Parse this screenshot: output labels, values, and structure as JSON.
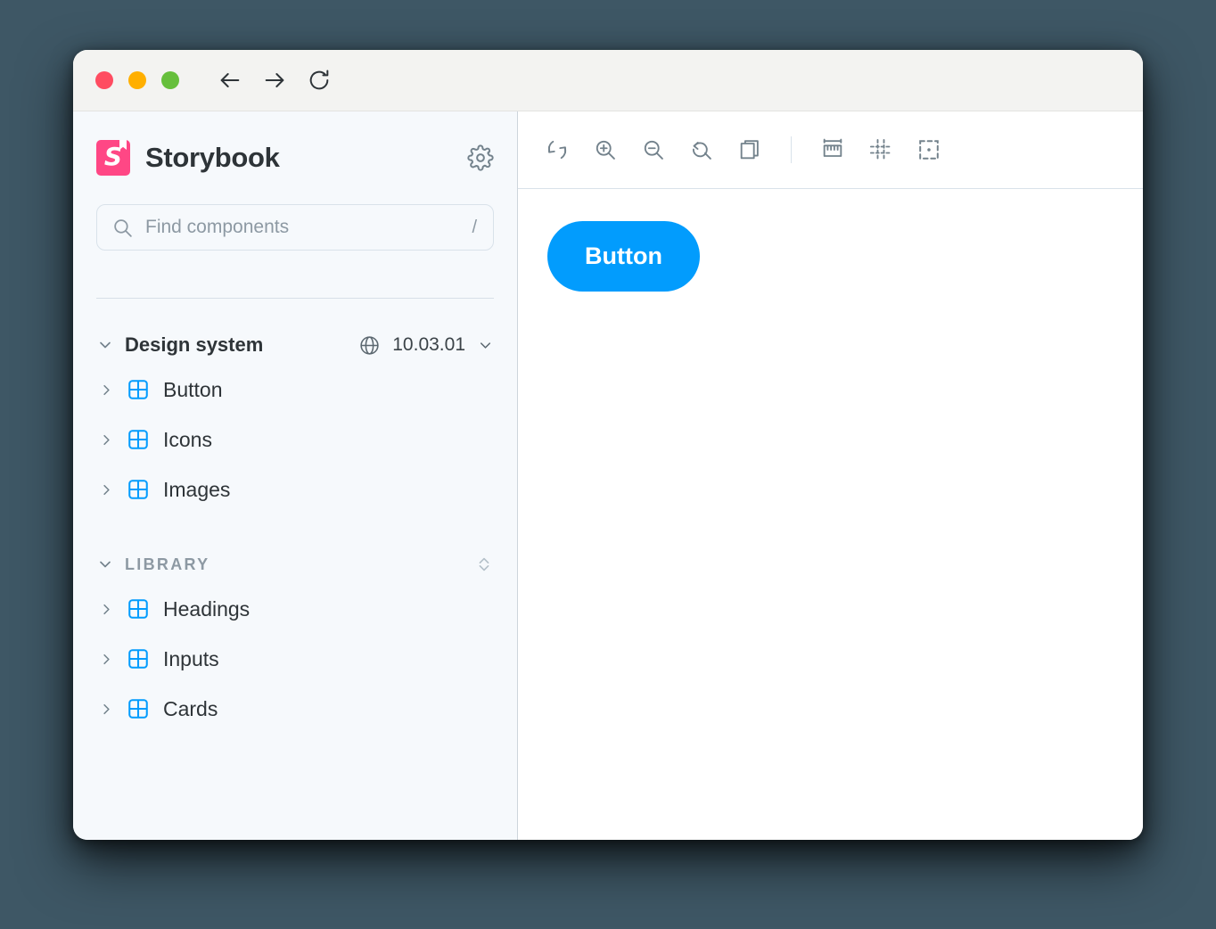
{
  "window": {
    "traffic_lights": [
      {
        "name": "close",
        "color": "#ff4c61"
      },
      {
        "name": "minimize",
        "color": "#ffaf00"
      },
      {
        "name": "maximize",
        "color": "#66bf3c"
      }
    ],
    "nav": [
      {
        "name": "back",
        "icon": "arrow-left-icon"
      },
      {
        "name": "forward",
        "icon": "arrow-right-icon"
      },
      {
        "name": "reload",
        "icon": "reload-icon"
      }
    ]
  },
  "sidebar": {
    "brand": {
      "title": "Storybook",
      "logo_letter": "S",
      "logo_color": "#ff4785"
    },
    "settings_icon": "gear-icon",
    "search": {
      "placeholder": "Find components",
      "value": "",
      "shortcut": "/"
    },
    "groups": [
      {
        "title": "Design system",
        "style": "bold",
        "expanded": true,
        "version": "10.03.01",
        "version_icon": "globe-icon",
        "items": [
          {
            "label": "Button"
          },
          {
            "label": "Icons"
          },
          {
            "label": "Images"
          }
        ]
      },
      {
        "title": "LIBRARY",
        "style": "caps",
        "expanded": true,
        "sort_icon": "sort-chevrons-icon",
        "items": [
          {
            "label": "Headings"
          },
          {
            "label": "Inputs"
          },
          {
            "label": "Cards"
          }
        ]
      }
    ]
  },
  "toolbar": {
    "left_group": [
      {
        "name": "remount-button",
        "icon": "refresh-icon"
      },
      {
        "name": "zoom-in-button",
        "icon": "zoom-in-icon"
      },
      {
        "name": "zoom-out-button",
        "icon": "zoom-out-icon"
      },
      {
        "name": "zoom-reset-button",
        "icon": "zoom-reset-icon"
      },
      {
        "name": "copy-button",
        "icon": "layers-icon"
      }
    ],
    "right_group": [
      {
        "name": "measure-button",
        "icon": "ruler-icon"
      },
      {
        "name": "grid-button",
        "icon": "grid-icon"
      },
      {
        "name": "outline-button",
        "icon": "outline-icon"
      }
    ]
  },
  "canvas": {
    "preview_button_label": "Button",
    "preview_button_color": "#029cfd"
  }
}
